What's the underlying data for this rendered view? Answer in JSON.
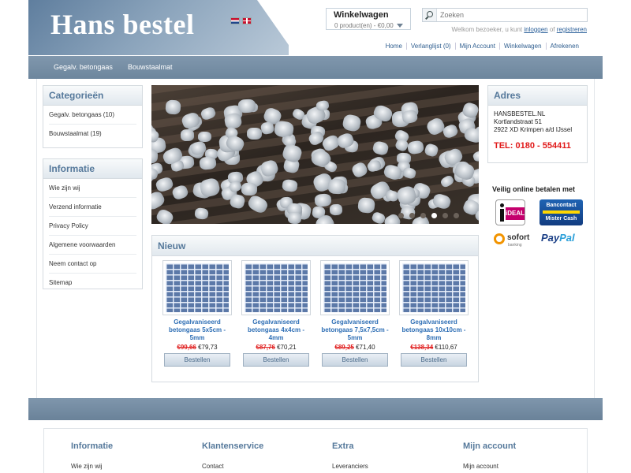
{
  "header": {
    "logo": "Hans bestel",
    "cart": {
      "title": "Winkelwagen",
      "summary": "0 product(en) - €0,00"
    },
    "search": {
      "placeholder": "Zoeken"
    },
    "welcome": {
      "text": "Welkom bezoeker, u kunt",
      "login": "inloggen",
      "or": "of",
      "register": "registreren"
    },
    "top_links": [
      "Home",
      "Verlanglijst (0)",
      "Mijn Account",
      "Winkelwagen",
      "Afrekenen"
    ]
  },
  "nav": {
    "items": [
      "Gegalv. betongaas",
      "Bouwstaalmat"
    ]
  },
  "sidebar": {
    "categories": {
      "title": "Categorieën",
      "items": [
        "Gegalv. betongaas (10)",
        "Bouwstaalmat (19)"
      ]
    },
    "info": {
      "title": "Informatie",
      "items": [
        "Wie zijn wij",
        "Verzend informatie",
        "Privacy Policy",
        "Algemene voorwaarden",
        "Neem contact op",
        "Sitemap"
      ]
    }
  },
  "new_products": {
    "title": "Nieuw",
    "products": [
      {
        "name": "Gegalvaniseerd betongaas 5x5cm - 5mm",
        "old_price": "€99,66",
        "price": "€79,73",
        "button": "Bestellen"
      },
      {
        "name": "Gegalvaniseerd betongaas 4x4cm - 4mm",
        "old_price": "€87,76",
        "price": "€70,21",
        "button": "Bestellen"
      },
      {
        "name": "Gegalvaniseerd betongaas 7,5x7,5cm - 5mm",
        "old_price": "€89,25",
        "price": "€71,40",
        "button": "Bestellen"
      },
      {
        "name": "Gegalvaniseerd betongaas 10x10cm - 8mm",
        "old_price": "€138,34",
        "price": "€110,67",
        "button": "Bestellen"
      }
    ]
  },
  "address": {
    "title": "Adres",
    "lines": [
      "HANSBESTEL.NL",
      "Kortlandstraat 51",
      "2922 XD Krimpen a/d IJssel"
    ],
    "phone": "TEL: 0180 - 554411"
  },
  "payment": {
    "title": "Veilig online betalen met",
    "ideal": "iDEAL",
    "bancontact": [
      "Bancontact",
      "Mister Cash"
    ],
    "sofort": "sofort",
    "sofort_sub": "banking",
    "paypal": [
      "Pay",
      "Pal"
    ]
  },
  "footer": {
    "columns": [
      {
        "title": "Informatie",
        "item": "Wie zijn wij"
      },
      {
        "title": "Klantenservice",
        "item": "Contact"
      },
      {
        "title": "Extra",
        "item": "Leveranciers"
      },
      {
        "title": "Mijn account",
        "item": "Mijn account"
      }
    ]
  },
  "colors": {
    "accent": "#56799b",
    "nav": "#6d869d",
    "link": "#2f6fb5",
    "sale": "#e02020"
  },
  "icons": [
    "search-icon",
    "flag-nl-icon",
    "flag-en-icon",
    "chevron-down-icon"
  ]
}
